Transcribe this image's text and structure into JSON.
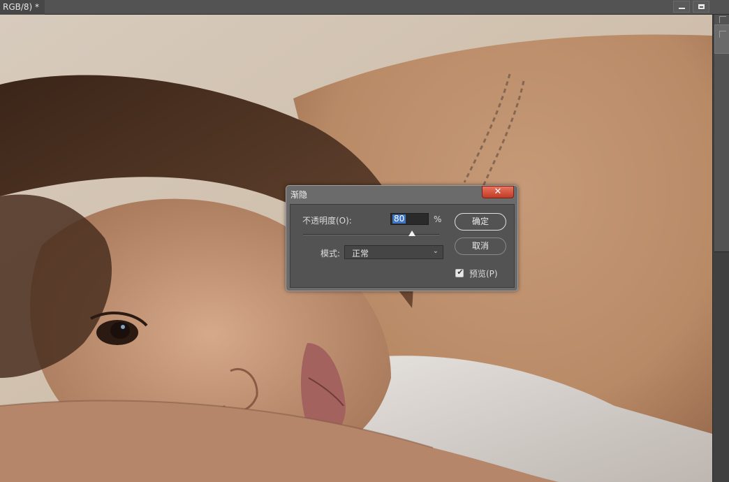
{
  "document": {
    "tab_title": "RGB/8) *"
  },
  "window_controls": {
    "minimize_icon": "minimize-icon",
    "maximize_icon": "maximize-icon"
  },
  "canvas": {
    "photo_subject": "photo-canvas"
  },
  "dialog": {
    "title": "渐隐",
    "close_symbol": "✕",
    "opacity_label": "不透明度(O):",
    "opacity_value": "80",
    "opacity_unit": "%",
    "opacity_slider_fraction": 0.8,
    "mode_label": "模式:",
    "mode_value": "正常",
    "ok_label": "确定",
    "cancel_label": "取消",
    "preview_label": "预览(P)",
    "preview_checked": true
  },
  "colors": {
    "close_button": "#c13b26",
    "selection": "#3d76c8",
    "dialog_bg": "#535353"
  }
}
